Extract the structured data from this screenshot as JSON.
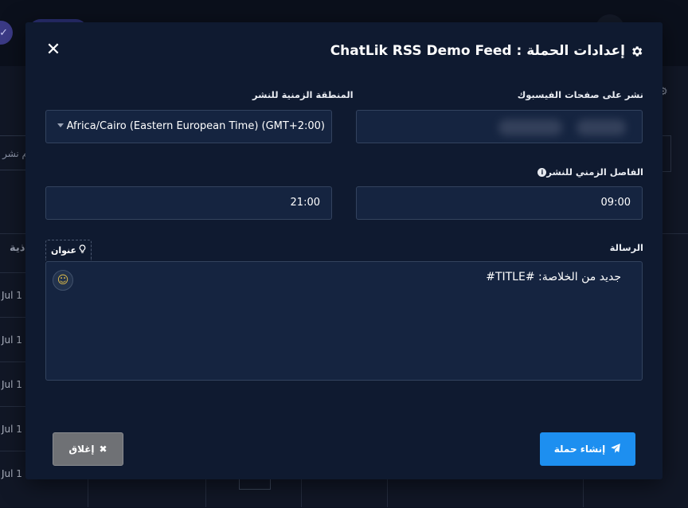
{
  "background": {
    "search_fragment": "م نشر",
    "column_header_fragment": "ذية",
    "row_dates": [
      "Jul 1",
      "Jul 1",
      "Jul 1",
      "Jul 1",
      "Jul 1"
    ]
  },
  "modal": {
    "title": "إعدادات الحملة : ChatLik RSS Demo Feed",
    "close_symbol": "✕",
    "facebook_pages": {
      "label": "نشر على صفحات الفيسبوك",
      "value": ""
    },
    "timezone": {
      "label": "المنطقة الزمنية للنشر",
      "selected": "Africa/Cairo (Eastern European Time) (GMT+2:00)"
    },
    "interval": {
      "label": "الفاصل الزمني للنشر",
      "info_symbol": "i",
      "from": "09:00",
      "to": "21:00"
    },
    "message": {
      "label": "الرسالة",
      "tag_chip_label": "عنوان",
      "value": "جديد من الخلاصة: #TITLE#"
    },
    "buttons": {
      "close_label": "إغلاق",
      "create_label": "إنشاء حملة"
    }
  },
  "colors": {
    "modal_bg": "#0f1a30",
    "field_bg": "#152440",
    "primary": "#1d8ff0",
    "secondary": "#6f7175"
  },
  "icons": {
    "title": "gear-icon",
    "close": "close-icon",
    "tag_chip": "lightbulb-icon",
    "emoji": "smiley-icon",
    "close_button": "times-icon",
    "create_button": "paper-plane-icon"
  }
}
